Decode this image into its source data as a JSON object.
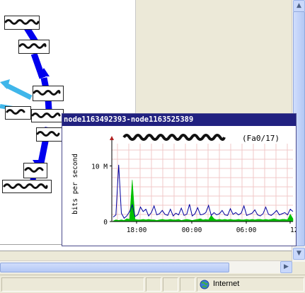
{
  "popup": {
    "title": "node1163492393-node1163525389",
    "interface_label": "(Fa0/17)",
    "ylabel": "bits per second"
  },
  "status_bar": {
    "zone": "Internet"
  },
  "chart_data": {
    "type": "area",
    "title": "(Fa0/17)",
    "xlabel": "",
    "ylabel": "bits per second",
    "y_tick_labels": [
      "0",
      "10 M"
    ],
    "x_tick_labels": [
      "18:00",
      "00:00",
      "06:00",
      "12"
    ],
    "ylim": [
      0,
      14000000
    ],
    "grid": true,
    "series": [
      {
        "color": "#00c000",
        "values": [
          0.1,
          0.3,
          0.2,
          0.3,
          0.2,
          0.5,
          0.4,
          7.5,
          0.4,
          0.3,
          0.3,
          0.4,
          0.3,
          0.4,
          0.3,
          0.3,
          0.2,
          0.3,
          0.4,
          0.3,
          0.3,
          0.4,
          0.3,
          0.3,
          0.4,
          0.2,
          0.3,
          0.4,
          0.3,
          0.2,
          0.3,
          0.4,
          0.5,
          0.3,
          0.4,
          0.3,
          1.1,
          0.5,
          0.3,
          0.4,
          0.3,
          0.4,
          0.3,
          0.4,
          0.3,
          0.3,
          0.4,
          0.3,
          0.3,
          0.4,
          0.3,
          0.4,
          0.3,
          0.4,
          0.4,
          0.3,
          0.4,
          0.3,
          0.4,
          0.5,
          0.4,
          0.3,
          0.4,
          0.4,
          0.3,
          1.3,
          0.5
        ]
      },
      {
        "color": "#0000a0",
        "values": [
          0.8,
          1.2,
          10.2,
          1.5,
          0.6,
          1.0,
          1.8,
          3.0,
          0.9,
          1.2,
          2.6,
          1.8,
          2.2,
          1.0,
          1.6,
          2.8,
          1.2,
          1.4,
          2.0,
          1.3,
          1.1,
          2.2,
          1.0,
          1.5,
          1.2,
          2.4,
          1.1,
          1.3,
          3.1,
          1.0,
          1.4,
          2.5,
          1.2,
          1.3,
          1.6,
          2.9,
          1.1,
          1.6,
          1.2,
          1.4,
          2.0,
          1.2,
          1.1,
          2.3,
          1.3,
          1.6,
          1.2,
          1.5,
          2.8,
          1.1,
          1.3,
          1.5,
          2.1,
          1.2,
          1.0,
          1.4,
          2.6,
          1.3,
          1.1,
          1.5,
          2.0,
          1.2,
          1.4,
          1.6,
          1.2,
          2.2,
          1.8
        ]
      }
    ]
  }
}
